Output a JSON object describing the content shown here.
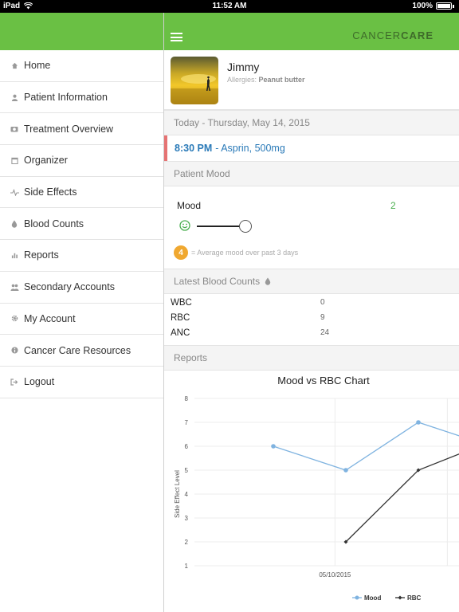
{
  "status": {
    "device": "iPad",
    "time": "11:52 AM",
    "battery": "100%"
  },
  "brand": {
    "prefix": "CANCER",
    "suffix": "CARE"
  },
  "sidebar": {
    "items": [
      {
        "label": "Home",
        "icon": "home-icon"
      },
      {
        "label": "Patient Information",
        "icon": "person-icon"
      },
      {
        "label": "Treatment Overview",
        "icon": "camera-icon"
      },
      {
        "label": "Organizer",
        "icon": "calendar-icon"
      },
      {
        "label": "Side Effects",
        "icon": "pulse-icon"
      },
      {
        "label": "Blood Counts",
        "icon": "drop-icon"
      },
      {
        "label": "Reports",
        "icon": "bar-chart-icon"
      },
      {
        "label": "Secondary Accounts",
        "icon": "people-icon"
      },
      {
        "label": "My Account",
        "icon": "gear-icon"
      },
      {
        "label": "Cancer Care Resources",
        "icon": "info-icon"
      },
      {
        "label": "Logout",
        "icon": "logout-icon"
      }
    ]
  },
  "profile": {
    "name": "Jimmy",
    "allergies_label": "Allergies:",
    "allergies_value": "Peanut butter"
  },
  "today": {
    "header": "Today - Thursday, May 14, 2015",
    "medication": {
      "time": "8:30 PM",
      "text": "- Asprin, 500mg"
    }
  },
  "mood": {
    "header": "Patient Mood",
    "label": "Mood",
    "value": "2",
    "average": "4",
    "average_text": "= Average mood over past 3 days"
  },
  "blood": {
    "header": "Latest Blood Counts",
    "rows": [
      {
        "name": "WBC",
        "value": "0"
      },
      {
        "name": "RBC",
        "value": "9"
      },
      {
        "name": "ANC",
        "value": "24"
      }
    ]
  },
  "reports": {
    "header": "Reports"
  },
  "chart_data": {
    "type": "line",
    "title": "Mood vs RBC Chart",
    "ylabel": "Side Effect Level",
    "xlabel": "",
    "ylim": [
      1,
      8
    ],
    "yticks": [
      1,
      2,
      3,
      4,
      5,
      6,
      7,
      8
    ],
    "xtick_label": "05/10/2015",
    "grid": true,
    "legend_position": "bottom-right",
    "series": [
      {
        "name": "Mood",
        "color": "#7fb3e0",
        "x": [
          0,
          1,
          2,
          3
        ],
        "values": [
          6,
          5,
          7,
          6
        ]
      },
      {
        "name": "RBC",
        "color": "#333333",
        "x": [
          1,
          2,
          3
        ],
        "values": [
          2,
          5,
          6.2
        ]
      }
    ]
  },
  "colors": {
    "brand_green": "#6ac044",
    "accent_blue": "#2a7ab8",
    "badge_orange": "#f0a830",
    "mood_green": "#4caf50"
  }
}
